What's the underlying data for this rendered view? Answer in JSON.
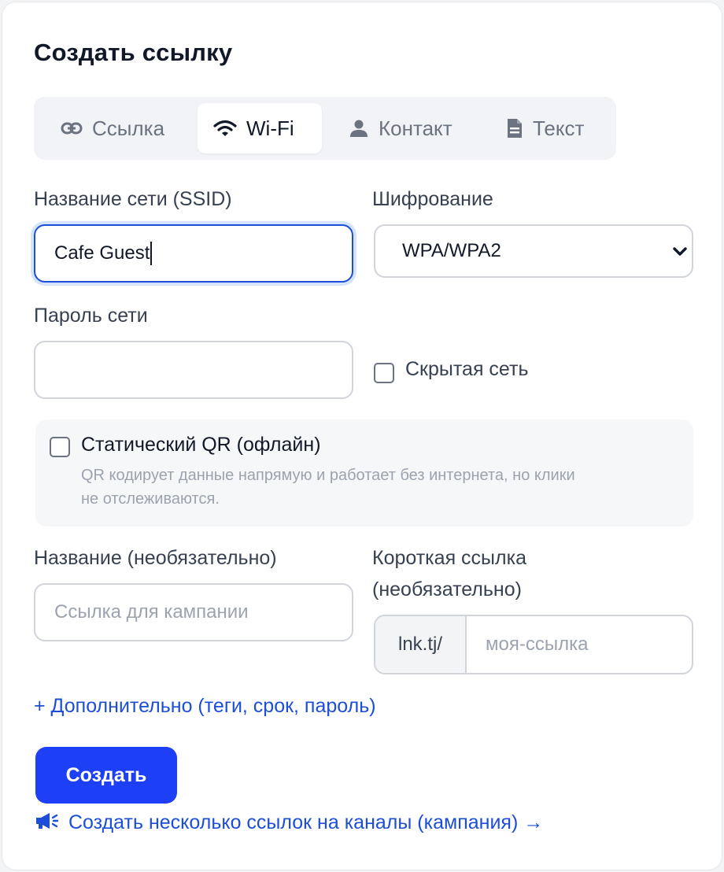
{
  "title": "Создать ссылку",
  "tabs": [
    {
      "label": "Ссылка",
      "icon": "link-icon"
    },
    {
      "label": "Wi-Fi",
      "icon": "wifi-icon",
      "active": true
    },
    {
      "label": "Контакт",
      "icon": "person-icon"
    },
    {
      "label": "Текст",
      "icon": "document-icon"
    }
  ],
  "form": {
    "ssid_label": "Название сети (SSID)",
    "ssid_value": "Cafe Guest",
    "encryption_label": "Шифрование",
    "encryption_value": "WPA/WPA2",
    "password_label": "Пароль сети",
    "password_value": "",
    "hidden_label": "Скрытая сеть",
    "hidden_checked": false,
    "static_qr_label": "Статический QR (офлайн)",
    "static_qr_checked": false,
    "static_qr_hint_1": "QR кодирует данные напрямую и работает без интернета, но клики",
    "static_qr_hint_2": "не отслеживаются.",
    "name_label": "Название (необязательно)",
    "name_placeholder": "Ссылка для кампании",
    "short_label_1": "Короткая ссылка",
    "short_label_2": "(необязательно)",
    "short_prefix": "lnk.tj/",
    "short_placeholder": "моя-ссылка",
    "advanced_link": "+ Дополнительно (теги, срок, пароль)",
    "create_button": "Создать",
    "campaign_link": "Создать несколько ссылок на каналы (кампания) →"
  },
  "colors": {
    "accent": "#1d3ff5",
    "link": "#1d4ed8",
    "focus_border": "#1d4ed8"
  }
}
